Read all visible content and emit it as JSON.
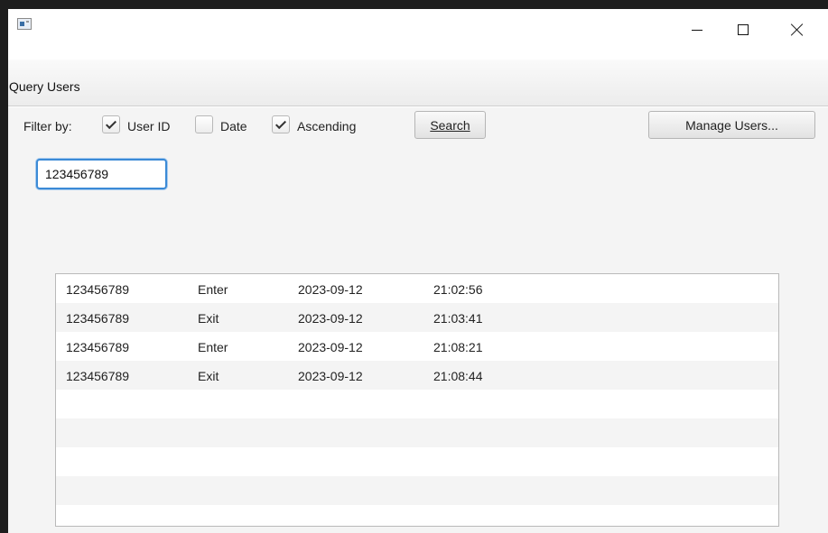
{
  "window": {
    "title": "",
    "controls": {
      "minimize": "minimize",
      "maximize": "maximize",
      "close": "close"
    }
  },
  "menu": {
    "items": [
      "Query Users"
    ]
  },
  "filter": {
    "label": "Filter by:",
    "options": [
      {
        "label": "User ID",
        "checked": true
      },
      {
        "label": "Date",
        "checked": false
      },
      {
        "label": "Ascending",
        "checked": true
      }
    ],
    "search_label": "Search",
    "manage_label": "Manage Users..."
  },
  "query_input": {
    "value": "123456789",
    "placeholder": ""
  },
  "results": {
    "rows": [
      [
        "123456789",
        "Enter",
        "2023-09-12",
        "21:02:56"
      ],
      [
        "123456789",
        "Exit",
        "2023-09-12",
        "21:03:41"
      ],
      [
        "123456789",
        "Enter",
        "2023-09-12",
        "21:08:21"
      ],
      [
        "123456789",
        "Exit",
        "2023-09-12",
        "21:08:44"
      ],
      [
        "",
        "",
        "",
        ""
      ],
      [
        "",
        "",
        "",
        ""
      ],
      [
        "",
        "",
        "",
        ""
      ],
      [
        "",
        "",
        "",
        ""
      ],
      [
        "",
        "",
        "",
        ""
      ]
    ]
  },
  "icons": {
    "app": "app-window-icon",
    "check": "checkmark-icon"
  }
}
